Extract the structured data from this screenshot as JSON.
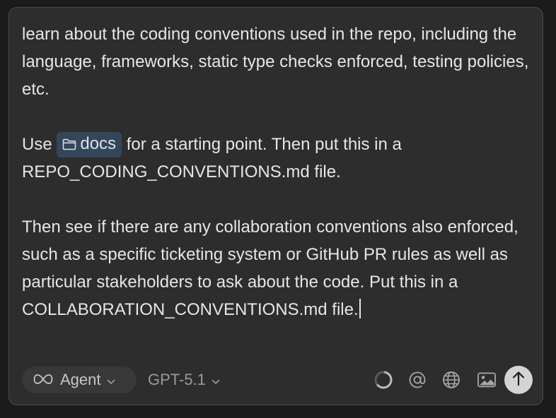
{
  "prompt": {
    "p1": "learn about the coding conventions used in the repo, including the language, frameworks, static type checks enforced, testing policies, etc.",
    "p2_before": "Use",
    "p2_chip": "docs",
    "p2_after": "for a starting point. Then put this in a REPO_CODING_CONVENTIONS.md file.",
    "p3": "Then see if there are any collaboration conventions also enforced, such as a specific ticketing system or GitHub PR rules as well as particular stakeholders to ask about the code. Put this in a COLLABORATION_CONVENTIONS.md file."
  },
  "toolbar": {
    "agent_label": "Agent",
    "agent_icon": "infinity-icon",
    "model_label": "GPT-5.1",
    "icons": [
      "loading-spinner-icon",
      "at-mention-icon",
      "globe-icon",
      "image-icon",
      "send-arrow-up-icon"
    ]
  },
  "colors": {
    "panel_bg": "#2d2d2d",
    "text": "#e6e6e6",
    "chip_bg": "#35465a",
    "send_bg": "#d4d4d4"
  }
}
